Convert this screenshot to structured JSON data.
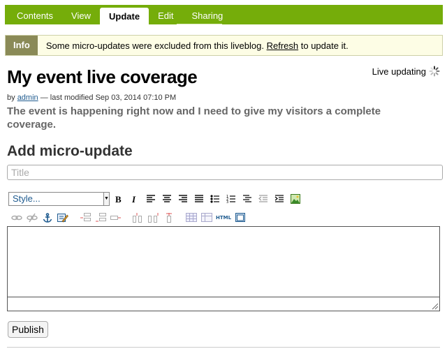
{
  "tabs": [
    {
      "label": "Contents"
    },
    {
      "label": "View"
    },
    {
      "label": "Update"
    },
    {
      "label": "Edit"
    },
    {
      "label": "Sharing"
    }
  ],
  "active_tab": "Update",
  "info": {
    "label": "Info",
    "message_before": "Some micro-updates were excluded from this liveblog.",
    "link": "Refresh",
    "message_after": "to update it."
  },
  "page": {
    "title": "My event live coverage",
    "live_status": "Live updating",
    "byline_prefix": "by",
    "author": "admin",
    "byline_suffix": "— last modified Sep 03, 2014 07:10 PM",
    "description": "The event is happening right now and I need to give my visitors a complete coverage."
  },
  "form": {
    "heading": "Add micro-update",
    "title_placeholder": "Title",
    "style_select": "Style...",
    "toolbar_html_label": "HTML",
    "publish_label": "Publish"
  },
  "colors": {
    "tabbar": "#75ad0a",
    "info_label": "#8a8a57",
    "info_bg": "#fdfde5"
  }
}
